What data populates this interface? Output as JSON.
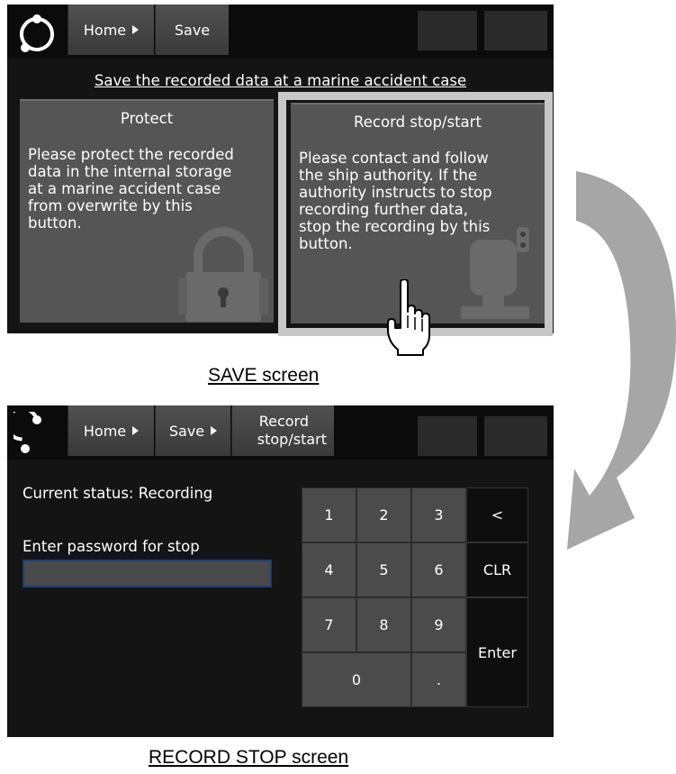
{
  "save_screen": {
    "nav": {
      "home": "Home",
      "save": "Save"
    },
    "headline": "Save the recorded data at a marine accident case",
    "protect_card": {
      "title": "Protect",
      "body": "Please protect the recorded\ndata in the internal storage\nat a marine accident case\nfrom overwrite by this\nbutton.",
      "icon": "padlock-icon"
    },
    "record_card": {
      "title": "Record stop/start",
      "body": "Please contact and follow\nthe ship authority. If the\nauthority instructs to stop\nrecording further data,\nstop the recording by this\nbutton.",
      "icon": "recorder-icon"
    },
    "caption": "SAVE screen"
  },
  "record_stop_screen": {
    "nav": {
      "home": "Home",
      "save": "Save",
      "record_line1": "Record",
      "record_line2": "stop/start"
    },
    "status": "Current status: Recording",
    "password_label": "Enter password for stop",
    "password_value": "",
    "keypad": {
      "k1": "1",
      "k2": "2",
      "k3": "3",
      "back": "<",
      "k4": "4",
      "k5": "5",
      "k6": "6",
      "clr": "CLR",
      "k7": "7",
      "k8": "8",
      "k9": "9",
      "enter": "Enter",
      "k0": "0",
      "dot": "."
    },
    "caption": "RECORD STOP screen"
  },
  "colors": {
    "screen_bg": "#141414",
    "card_bg": "#555555",
    "highlight": "#c7c7c7",
    "arrow": "#a6a6a6",
    "input_border": "#1d3d78"
  },
  "icons": [
    "app-logo-icon",
    "pointing-hand-icon",
    "curved-arrow-icon"
  ]
}
